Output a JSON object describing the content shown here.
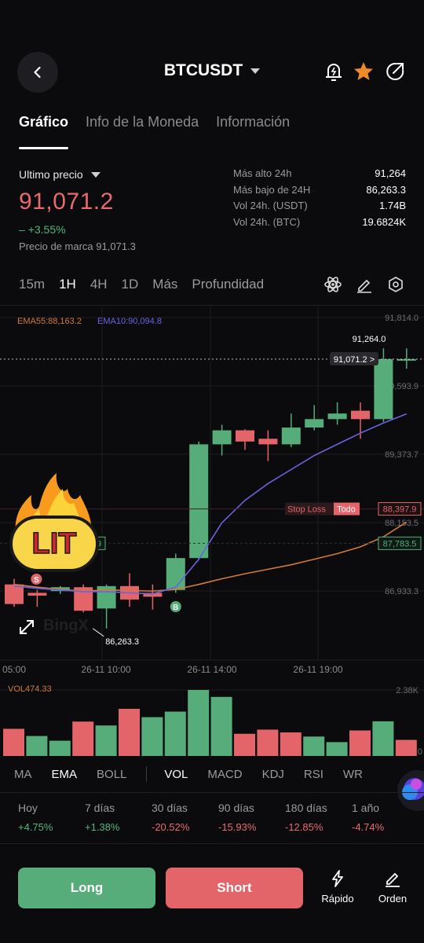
{
  "header": {
    "pair": "BTCUSDT",
    "icons": [
      "back-arrow-icon",
      "price-alert-icon",
      "star-icon",
      "share-icon"
    ]
  },
  "tabs": [
    {
      "label": "Gráfico",
      "active": true
    },
    {
      "label": "Info de la Moneda",
      "active": false
    },
    {
      "label": "Información",
      "active": false
    }
  ],
  "price": {
    "label": "Ultimo precio",
    "value": "91,071.2",
    "change_prefix": "–",
    "change": "+3.55%",
    "mark_label": "Precio de marca",
    "mark_value": "91,071.3"
  },
  "stats": [
    {
      "label": "Más alto 24h",
      "value": "91,264"
    },
    {
      "label": "Más bajo de 24H",
      "value": "86,263.3"
    },
    {
      "label": "Vol 24h. (USDT)",
      "value": "1.74B"
    },
    {
      "label": "Vol 24h. (BTC)",
      "value": "19.6824K"
    }
  ],
  "timeframes": [
    {
      "label": "15m",
      "active": false
    },
    {
      "label": "1H",
      "active": true
    },
    {
      "label": "4H",
      "active": false
    },
    {
      "label": "1D",
      "active": false
    },
    {
      "label": "Más",
      "active": false
    },
    {
      "label": "Profundidad",
      "active": false
    }
  ],
  "chart_icons": [
    "indicator-atom-icon",
    "draw-pencil-icon",
    "settings-hexagon-icon",
    "expand-icon"
  ],
  "chart": {
    "ema55_label": "EMA55:88,163.2",
    "ema10_label": "EMA10:90,094.8",
    "y_ticks": [
      "91,814.0",
      "90,593.9",
      "89,373.7",
      "88,153.5",
      "86,933.3"
    ],
    "x_ticks": [
      "05:00",
      "26-11 10:00",
      "26-11 14:00",
      "26-11 19:00"
    ],
    "high_marker": "91,264.0",
    "current_price_tag": "91,071.2 >",
    "low_marker": "86,263.3",
    "stop_loss_label": "Stop Loss",
    "stop_loss_all": "Todo",
    "stop_loss_price": "88,397.9",
    "green_line_price": "87,783.5",
    "left_tag_value": "9",
    "sell_marker": "S",
    "buy_marker": "B",
    "watermark": "BingX",
    "sticker_text": "LIT",
    "colors": {
      "up": "#56ad7a",
      "down": "#e46569",
      "ema10": "#6a63e0",
      "ema55": "#d27a3a"
    }
  },
  "chart_data": {
    "type": "candlestick",
    "interval": "1H",
    "candles": [
      {
        "open": 87050,
        "high": 87150,
        "low": 86650,
        "close": 86700
      },
      {
        "open": 86900,
        "high": 86950,
        "low": 86650,
        "close": 86850
      },
      {
        "open": 86930,
        "high": 87020,
        "low": 86880,
        "close": 87000
      },
      {
        "open": 87000,
        "high": 87050,
        "low": 86550,
        "close": 86580
      },
      {
        "open": 86620,
        "high": 87050,
        "low": 86263.3,
        "close": 87020
      },
      {
        "open": 87020,
        "high": 87250,
        "low": 86650,
        "close": 86780
      },
      {
        "open": 86900,
        "high": 87050,
        "low": 86600,
        "close": 86830
      },
      {
        "open": 86950,
        "high": 87600,
        "low": 86900,
        "close": 87520
      },
      {
        "open": 87520,
        "high": 89600,
        "low": 87500,
        "close": 89550
      },
      {
        "open": 89550,
        "high": 89900,
        "low": 89350,
        "close": 89800
      },
      {
        "open": 89800,
        "high": 89820,
        "low": 89450,
        "close": 89600
      },
      {
        "open": 89650,
        "high": 89800,
        "low": 89250,
        "close": 89550
      },
      {
        "open": 89550,
        "high": 90100,
        "low": 89500,
        "close": 89850
      },
      {
        "open": 89850,
        "high": 90250,
        "low": 89800,
        "close": 90000
      },
      {
        "open": 90000,
        "high": 90300,
        "low": 89900,
        "close": 90100
      },
      {
        "open": 90150,
        "high": 90300,
        "low": 89650,
        "close": 90000
      },
      {
        "open": 90000,
        "high": 91264,
        "low": 89950,
        "close": 91071.2
      },
      {
        "open": 91071.2,
        "high": 91264,
        "low": 90900,
        "close": 91071.2
      }
    ],
    "ema55": [
      87050,
      87000,
      86960,
      86930,
      86950,
      86940,
      86930,
      86960,
      87050,
      87150,
      87240,
      87320,
      87400,
      87500,
      87600,
      87720,
      87900,
      88163.2
    ],
    "ema10": [
      87020,
      86980,
      86950,
      86920,
      86920,
      86900,
      86880,
      87000,
      87500,
      88150,
      88550,
      88850,
      89100,
      89350,
      89550,
      89750,
      89930,
      90094.8
    ],
    "volume": [
      {
        "value": 0.98,
        "dir": "down"
      },
      {
        "value": 0.72,
        "dir": "up"
      },
      {
        "value": 0.55,
        "dir": "up"
      },
      {
        "value": 1.24,
        "dir": "down"
      },
      {
        "value": 1.1,
        "dir": "up"
      },
      {
        "value": 1.7,
        "dir": "down"
      },
      {
        "value": 1.4,
        "dir": "up"
      },
      {
        "value": 1.6,
        "dir": "up"
      },
      {
        "value": 2.38,
        "dir": "up"
      },
      {
        "value": 2.13,
        "dir": "up"
      },
      {
        "value": 0.8,
        "dir": "down"
      },
      {
        "value": 0.95,
        "dir": "down"
      },
      {
        "value": 0.85,
        "dir": "down"
      },
      {
        "value": 0.7,
        "dir": "up"
      },
      {
        "value": 0.5,
        "dir": "up"
      },
      {
        "value": 0.92,
        "dir": "down"
      },
      {
        "value": 1.25,
        "dir": "up"
      },
      {
        "value": 0.58,
        "dir": "down"
      }
    ],
    "volume_label": "VOL474.33",
    "volume_max_label": "2.38K",
    "volume_min_label": "0"
  },
  "indicators": {
    "main": [
      {
        "label": "MA",
        "active": false
      },
      {
        "label": "EMA",
        "active": true
      },
      {
        "label": "BOLL",
        "active": false
      }
    ],
    "sub": [
      {
        "label": "VOL",
        "active": true
      },
      {
        "label": "MACD",
        "active": false
      },
      {
        "label": "KDJ",
        "active": false
      },
      {
        "label": "RSI",
        "active": false
      },
      {
        "label": "WR",
        "active": false
      }
    ]
  },
  "performance": [
    {
      "label": "Hoy",
      "value": "+4.75%",
      "dir": "up"
    },
    {
      "label": "7 días",
      "value": "+1.38%",
      "dir": "up"
    },
    {
      "label": "30 días",
      "value": "-20.52%",
      "dir": "down"
    },
    {
      "label": "90 días",
      "value": "-15.93%",
      "dir": "down"
    },
    {
      "label": "180 días",
      "value": "-12.85%",
      "dir": "down"
    },
    {
      "label": "1 año",
      "value": "-4.74%",
      "dir": "down"
    }
  ],
  "actions": {
    "long": "Long",
    "short": "Short",
    "quick": "Rápido",
    "order": "Orden"
  }
}
